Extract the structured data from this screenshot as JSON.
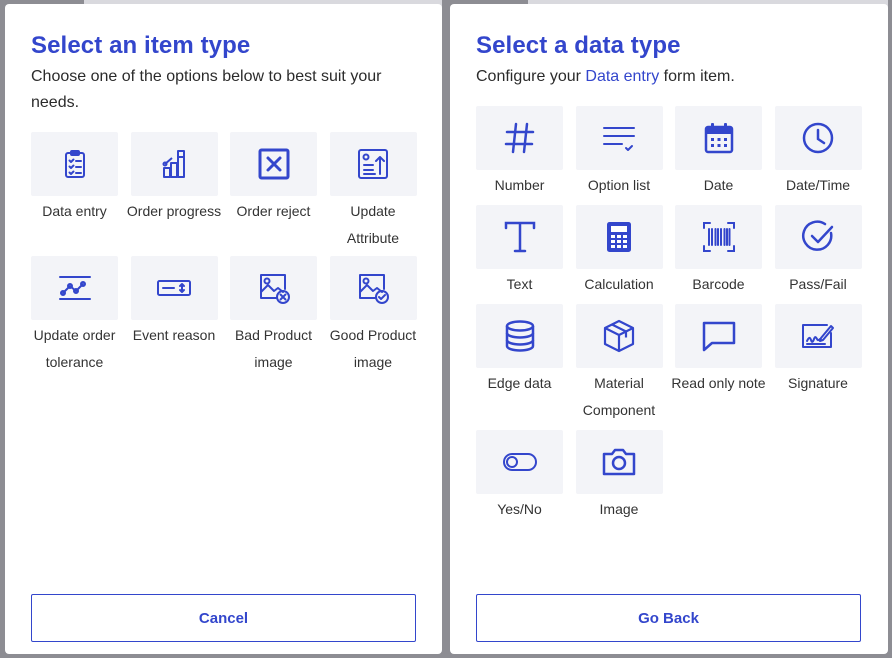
{
  "colors": {
    "accent": "#3346cc",
    "tile_bg": "#f3f4f8",
    "overlay": "#8e8e94"
  },
  "left_panel": {
    "title": "Select an item type",
    "subtitle": "Choose one of the options below to best suit your needs.",
    "items": [
      {
        "label": "Data entry",
        "icon": "clipboard-list-icon"
      },
      {
        "label": "Order progress",
        "icon": "progress-chart-icon"
      },
      {
        "label": "Order reject",
        "icon": "reject-x-icon"
      },
      {
        "label": "Update Attribute",
        "icon": "update-attribute-icon"
      },
      {
        "label": "Update order tolerance",
        "icon": "tolerance-icon"
      },
      {
        "label": "Event reason",
        "icon": "event-reason-icon"
      },
      {
        "label": "Bad Product image",
        "icon": "bad-image-icon"
      },
      {
        "label": "Good Product image",
        "icon": "good-image-icon"
      }
    ],
    "button_label": "Cancel"
  },
  "right_panel": {
    "title": "Select a data type",
    "subtitle_before": "Configure your ",
    "subtitle_link": "Data entry",
    "subtitle_after": " form item.",
    "items": [
      {
        "label": "Number",
        "icon": "hash-icon"
      },
      {
        "label": "Option list",
        "icon": "option-list-icon"
      },
      {
        "label": "Date",
        "icon": "calendar-icon"
      },
      {
        "label": "Date/Time",
        "icon": "clock-icon"
      },
      {
        "label": "Text",
        "icon": "text-icon"
      },
      {
        "label": "Calculation",
        "icon": "calculator-icon"
      },
      {
        "label": "Barcode",
        "icon": "barcode-icon"
      },
      {
        "label": "Pass/Fail",
        "icon": "check-circle-icon"
      },
      {
        "label": "Edge data",
        "icon": "database-icon"
      },
      {
        "label": "Material Component",
        "icon": "box-icon"
      },
      {
        "label": "Read only note",
        "icon": "message-icon"
      },
      {
        "label": "Signature",
        "icon": "signature-icon"
      },
      {
        "label": "Yes/No",
        "icon": "toggle-icon"
      },
      {
        "label": "Image",
        "icon": "camera-icon"
      }
    ],
    "button_label": "Go Back"
  }
}
